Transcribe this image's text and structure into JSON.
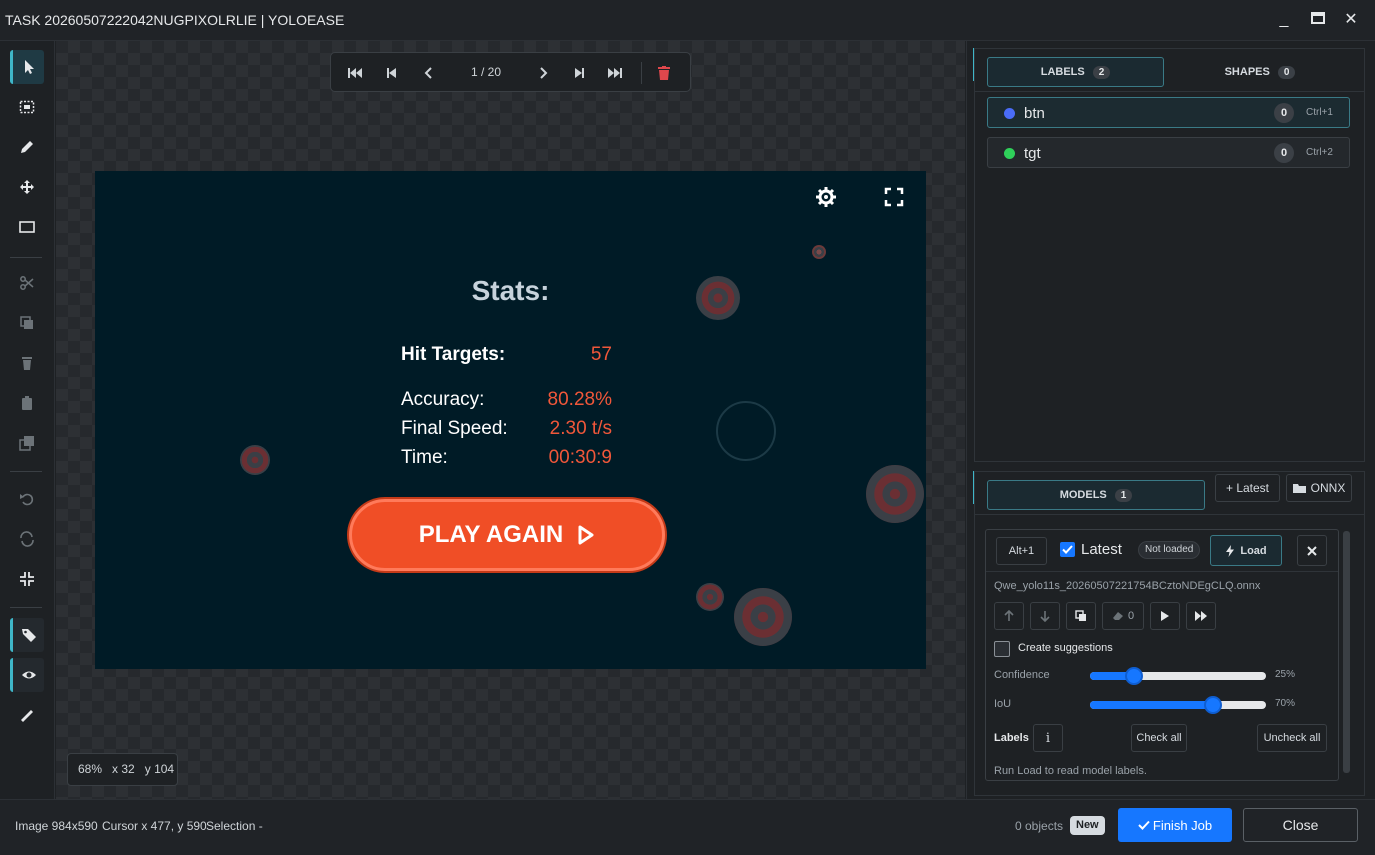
{
  "window": {
    "title": "TASK 20260507222042NUGPIXOLRLIE | YOLOEASE",
    "minimize_glyph": "_",
    "maximize_glyph": "▭",
    "close_glyph": "✕"
  },
  "toolbar": {
    "tools": [
      "select-icon",
      "box-select-icon",
      "pencil-icon",
      "move-icon",
      "rectangle-icon",
      "scissors-icon",
      "copy-icon",
      "trash-icon",
      "clipboard-icon",
      "duplicate-icon",
      "undo-icon",
      "redo-icon",
      "collapse-icon",
      "tag-icon",
      "eye-icon",
      "ruler-icon"
    ]
  },
  "navigation": {
    "page": "1 / 20"
  },
  "image": {
    "stats_title": "Stats:",
    "hit_targets_label": "Hit Targets:",
    "hit_targets_value": "57",
    "accuracy_label": "Accuracy:",
    "accuracy_value": "80.28%",
    "final_speed_label": "Final Speed:",
    "final_speed_value": "2.30 t/s",
    "time_label": "Time:",
    "time_value": "00:30:9",
    "play_again": "PLAY AGAIN"
  },
  "zoom_info": {
    "zoom": "68%",
    "x": "x 32",
    "y": "y 104"
  },
  "labels_panel": {
    "tab_labels": "LABELS",
    "tab_labels_count": "2",
    "tab_shapes": "SHAPES",
    "tab_shapes_count": "0",
    "items": [
      {
        "name": "btn",
        "count": "0",
        "shortcut": "Ctrl+1",
        "color": "#4a6cf7"
      },
      {
        "name": "tgt",
        "count": "0",
        "shortcut": "Ctrl+2",
        "color": "#2fd05a"
      }
    ]
  },
  "models_panel": {
    "tab_models": "MODELS",
    "tab_models_count": "1",
    "latest_button": "+ Latest",
    "onnx_button": "ONNX",
    "model": {
      "shortcut": "Alt+1",
      "name": "Latest",
      "status": "Not loaded",
      "load_button": "Load",
      "file": "Qwe_yolo11s_20260507221754BCztoNDEgCLQ.onnx",
      "counter": "0",
      "create_suggestions": "Create suggestions",
      "confidence_label": "Confidence",
      "confidence_value": "25%",
      "confidence_fraction": 0.25,
      "iou_label": "IoU",
      "iou_value": "70%",
      "iou_fraction": 0.7,
      "labels_label": "Labels",
      "check_all": "Check all",
      "uncheck_all": "Uncheck all",
      "hint": "Run Load to read model labels."
    }
  },
  "status_bar": {
    "image_size": "Image 984x590",
    "cursor": "Cursor x 477, y 590",
    "selection": "Selection -",
    "objects": "0 objects",
    "new_badge": "New",
    "finish_job": "Finish Job",
    "close": "Close"
  },
  "colors": {
    "accent": "#3fb6c8",
    "primary": "#1677ff",
    "play_button": "#f04e26",
    "stat_value": "#f0573a",
    "delete": "#e0474c"
  }
}
